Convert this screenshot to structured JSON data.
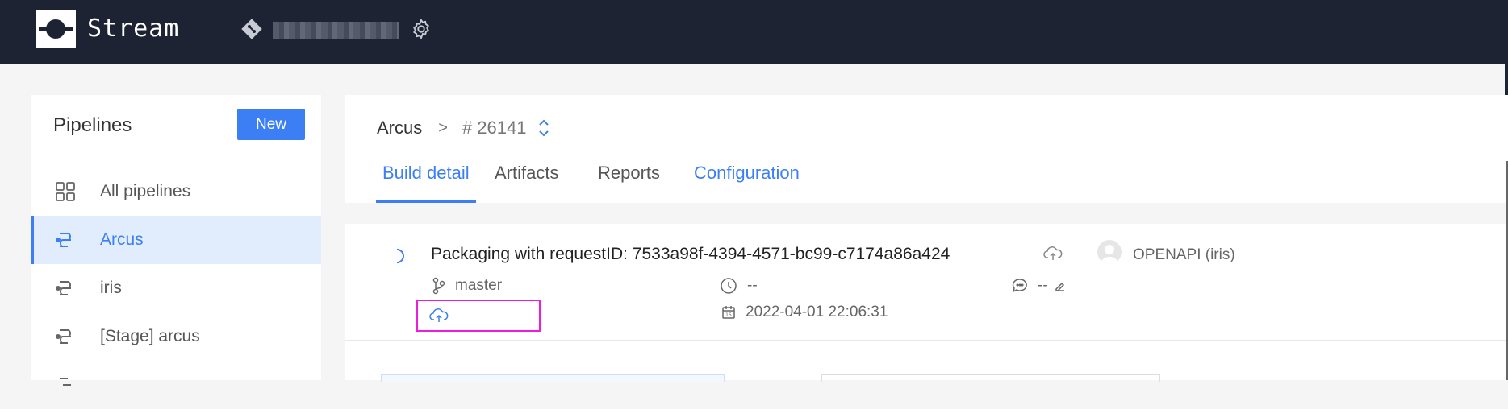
{
  "header": {
    "brand": "Stream",
    "icons": [
      "git-icon",
      "gear-icon"
    ]
  },
  "sidebar": {
    "title": "Pipelines",
    "new_label": "New",
    "items": [
      {
        "label": "All pipelines",
        "icon": "grid-icon",
        "active": false
      },
      {
        "label": "Arcus",
        "icon": "pipeline-icon",
        "active": true
      },
      {
        "label": "iris",
        "icon": "pipeline-icon",
        "active": false
      },
      {
        "label": "[Stage] arcus",
        "icon": "pipeline-icon",
        "active": false
      }
    ]
  },
  "breadcrumb": {
    "pipeline": "Arcus",
    "separator": ">",
    "build_number": "# 26141"
  },
  "tabs": [
    {
      "label": "Build detail",
      "state": "active"
    },
    {
      "label": "Artifacts",
      "state": "normal"
    },
    {
      "label": "Reports",
      "state": "normal"
    },
    {
      "label": "Configuration",
      "state": "link"
    }
  ],
  "build": {
    "title": "Packaging with requestID: 7533a98f-4394-4571-bc99-c7174a86a424",
    "author": "OPENAPI  (iris)",
    "branch": "master",
    "duration": "--",
    "comment": "--",
    "datetime": "2022-04-01 22:06:31"
  },
  "colors": {
    "topbar": "#1d2333",
    "accent": "#3c7ff5",
    "active_bg": "#e1edfd",
    "highlight": "#ee1ce0"
  }
}
